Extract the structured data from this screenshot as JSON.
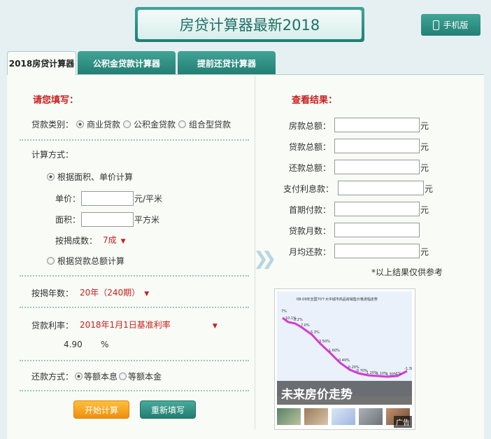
{
  "header": {
    "title": "房贷计算器最新2018",
    "mobile_label": "手机版"
  },
  "tabs": [
    {
      "label": "2018房贷计算器",
      "active": true
    },
    {
      "label": "公积金贷款计算器",
      "active": false
    },
    {
      "label": "提前还贷计算器",
      "active": false
    }
  ],
  "form": {
    "heading": "请您填写：",
    "loan_type_label": "贷款类别：",
    "loan_types": [
      "商业贷款",
      "公积金贷款",
      "组合型贷款"
    ],
    "calc_method_label": "计算方式：",
    "method_area": "根据面积、单价计算",
    "unit_price_label": "单价：",
    "unit_price_value": "",
    "unit_price_unit": "元/平米",
    "area_label": "面积：",
    "area_value": "",
    "area_unit": "平方米",
    "ratio_label": "按揭成数：",
    "ratio_value": "7成",
    "method_total": "根据贷款总额计算",
    "years_label": "按揭年数：",
    "years_value": "20年（240期）",
    "rate_label": "贷款利率：",
    "rate_value": "2018年1月1日基准利率",
    "rate_number": "4.90",
    "rate_percent": "%",
    "repay_label": "还款方式：",
    "repay_options": [
      "等额本息",
      "等额本金"
    ],
    "start_button": "开始计算",
    "reset_button": "重新填写"
  },
  "results": {
    "heading": "查看结果：",
    "rows": [
      {
        "label": "房款总额：",
        "unit": "元"
      },
      {
        "label": "贷款总额：",
        "unit": "元"
      },
      {
        "label": "还款总额：",
        "unit": "元"
      },
      {
        "label": "支付利息款：",
        "unit": "元"
      },
      {
        "label": "首期付款：",
        "unit": "元"
      },
      {
        "label": "贷款月数：",
        "unit": ""
      },
      {
        "label": "月均还款：",
        "unit": "元"
      }
    ],
    "note": "*以上结果仅供参考"
  },
  "ad": {
    "caption": "未来房价走势",
    "chart_title": "08-09年全国70个大中城市商品房销售价格涨幅走势",
    "labels": [
      "7%",
      "10.1%",
      "8.2%",
      "7.0%",
      "5.3%",
      "3.50%",
      "1.60%",
      "0.40%",
      "-0.20%",
      "-0.70%",
      "-1.20%",
      "-1.10%",
      "-1.30%",
      "-1%",
      "-1.30%"
    ],
    "ad_tag": "广告"
  },
  "colors": {
    "accent": "#2a8b7e",
    "red": "#c8201e",
    "orange": "#f4a020"
  }
}
